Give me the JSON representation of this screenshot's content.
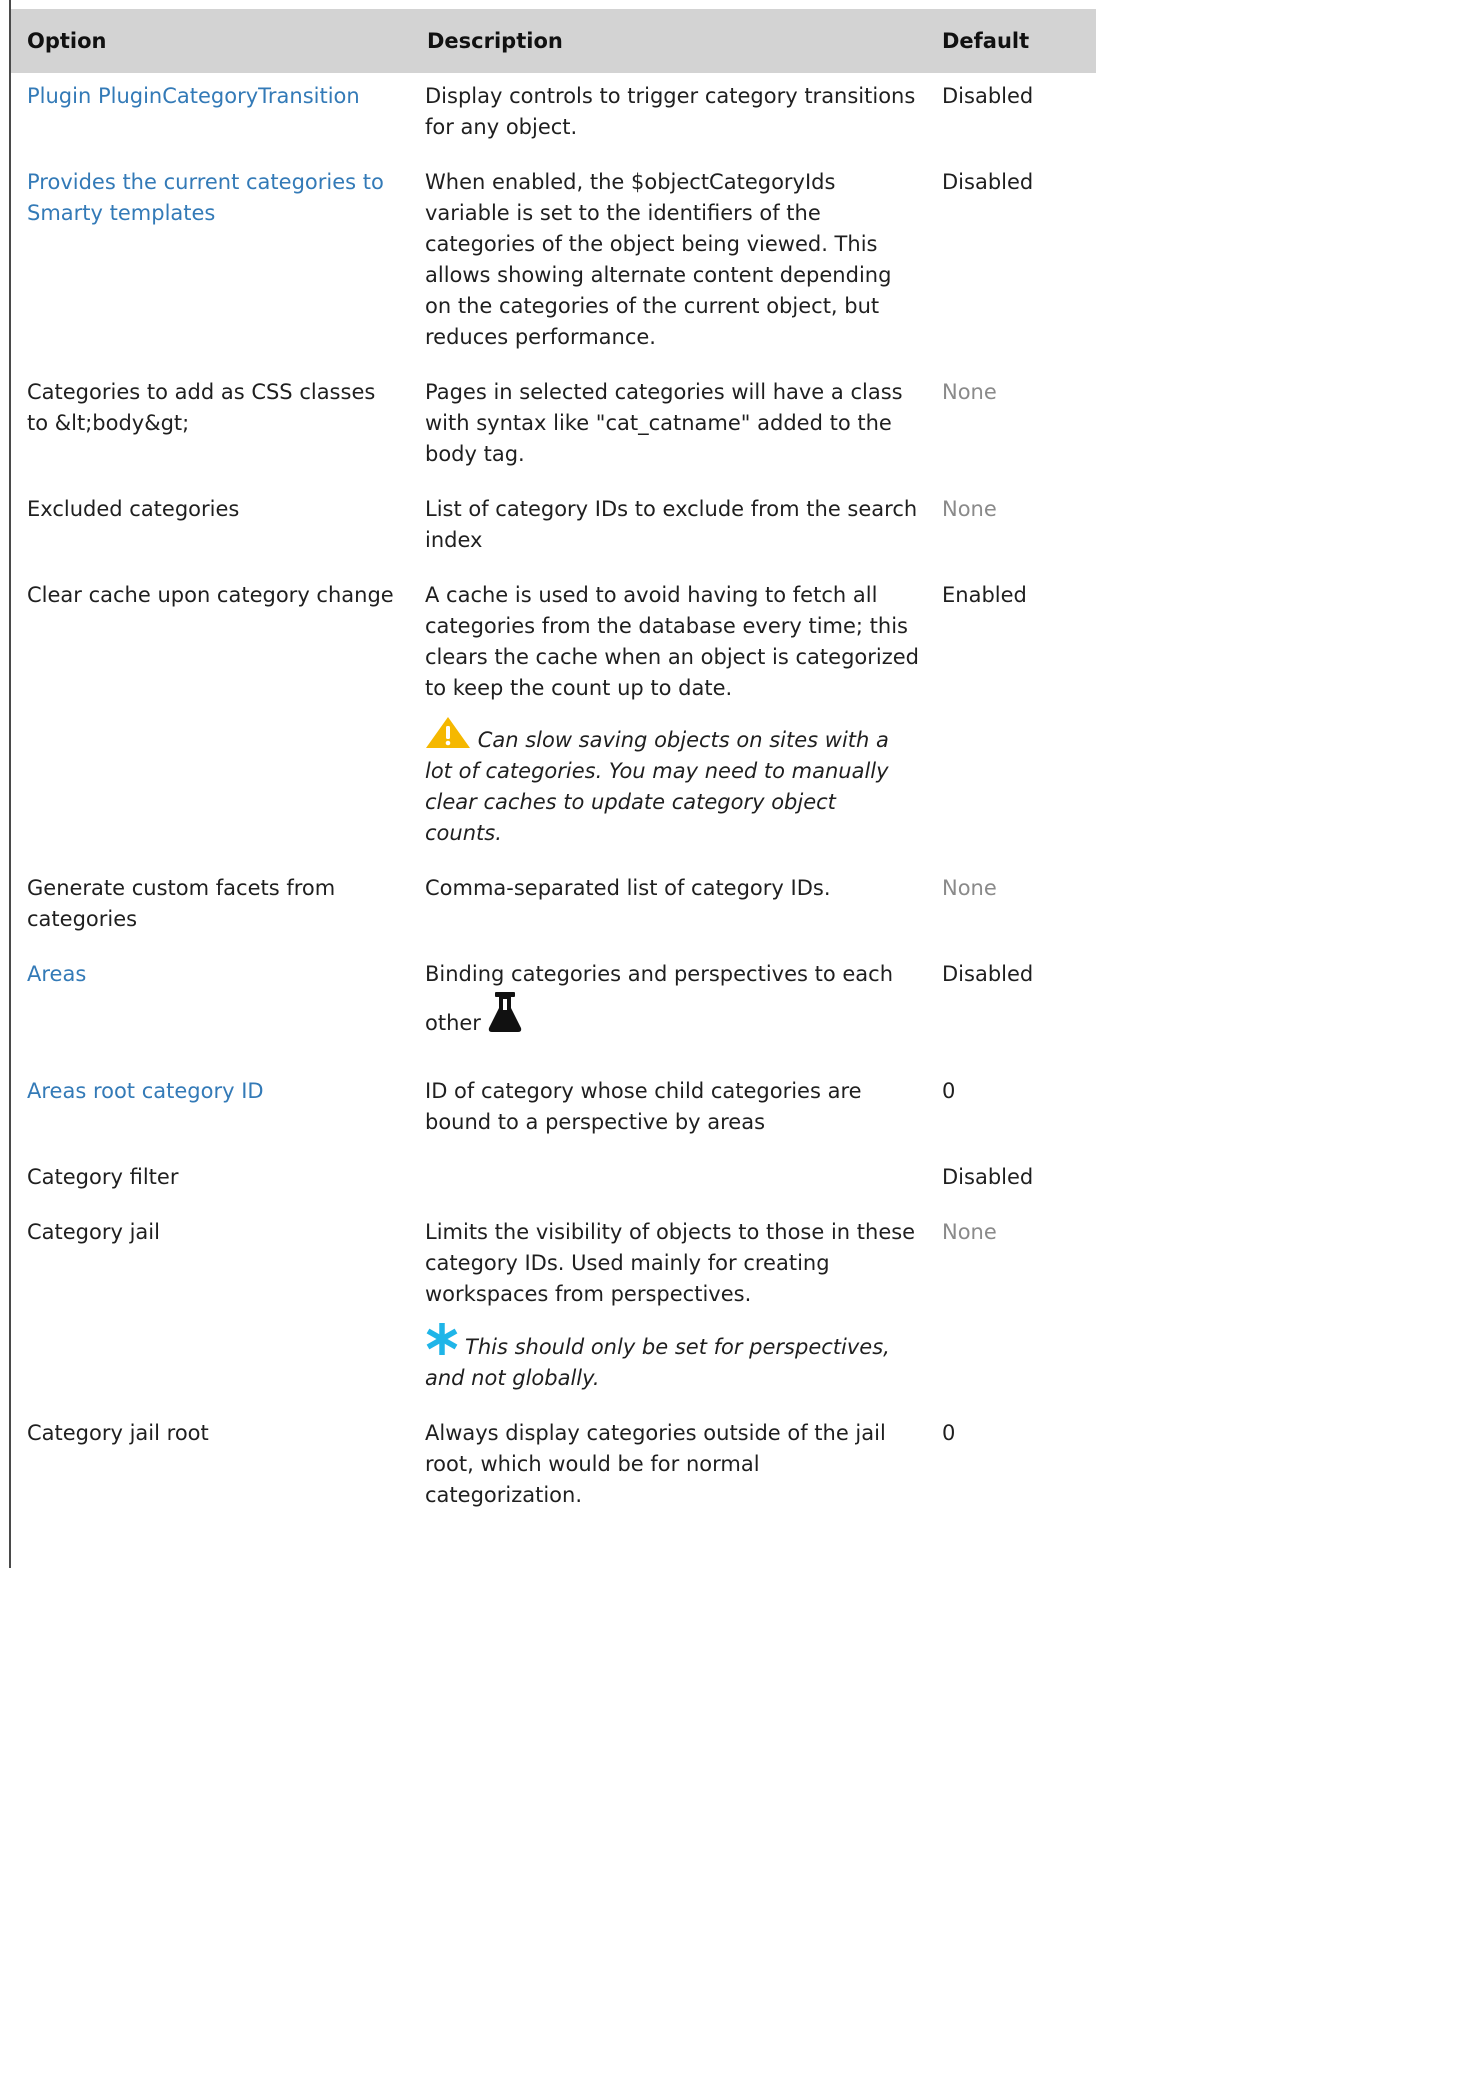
{
  "table": {
    "headers": {
      "option": "Option",
      "description": "Description",
      "default": "Default"
    },
    "rows": [
      {
        "option": "Plugin PluginCategoryTransition",
        "option_is_link": true,
        "description": "Display controls to trigger category transitions for any object.",
        "default": "Disabled"
      },
      {
        "option": "Provides the current categories to Smarty templates",
        "option_is_link": true,
        "description": "When enabled, the $objectCategoryIds variable is set to the identifiers of the categories of the object being viewed. This allows showing alternate content depending on the categories of the current object, but reduces performance.",
        "default": "Disabled"
      },
      {
        "option": "Categories to add as CSS classes to &lt;body&gt;",
        "option_is_link": false,
        "description": "Pages in selected categories will have a class with syntax like \"cat_catname\" added to the body tag.",
        "default": "None"
      },
      {
        "option": "Excluded categories",
        "option_is_link": false,
        "description": "List of category IDs to exclude from the search index",
        "default": "None"
      },
      {
        "option": "Clear cache upon category change",
        "option_is_link": false,
        "description": "A cache is used to avoid having to fetch all categories from the database every time; this clears the cache when an object is categorized to keep the count up to date.",
        "note": "Can slow saving objects on sites with a lot of categories. You may need to manually clear caches to update category object counts.",
        "note_icon": "warning-icon",
        "default": "Enabled"
      },
      {
        "option": "Generate custom facets from categories",
        "option_is_link": false,
        "description": "Comma-separated list of category IDs.",
        "default": "None"
      },
      {
        "option": "Areas",
        "option_is_link": true,
        "description_line1": "Binding categories and perspectives to each",
        "description_line2": "other",
        "description_icon": "flask-icon",
        "default": "Disabled"
      },
      {
        "option": "Areas root category ID",
        "option_is_link": true,
        "description": "ID of category whose child categories are bound to a perspective by areas",
        "default": "0"
      },
      {
        "option": "Category filter",
        "option_is_link": false,
        "description": "",
        "default": "Disabled"
      },
      {
        "option": "Category jail",
        "option_is_link": false,
        "description": "Limits the visibility of objects to those in these category IDs. Used mainly for creating workspaces from perspectives.",
        "note": "This should only be set for perspectives, and not globally.",
        "note_icon": "asterisk-icon",
        "default": "None"
      },
      {
        "option": "Category jail root",
        "option_is_link": false,
        "description": "Always display categories outside of the jail root, which would be for normal categorization.",
        "default": "0"
      }
    ]
  },
  "colors": {
    "link": "#337ab7",
    "header_bg": "#d3d3d3",
    "muted": "#8a8a8a",
    "warning": "#f5b800",
    "info": "#1fb5e8"
  }
}
